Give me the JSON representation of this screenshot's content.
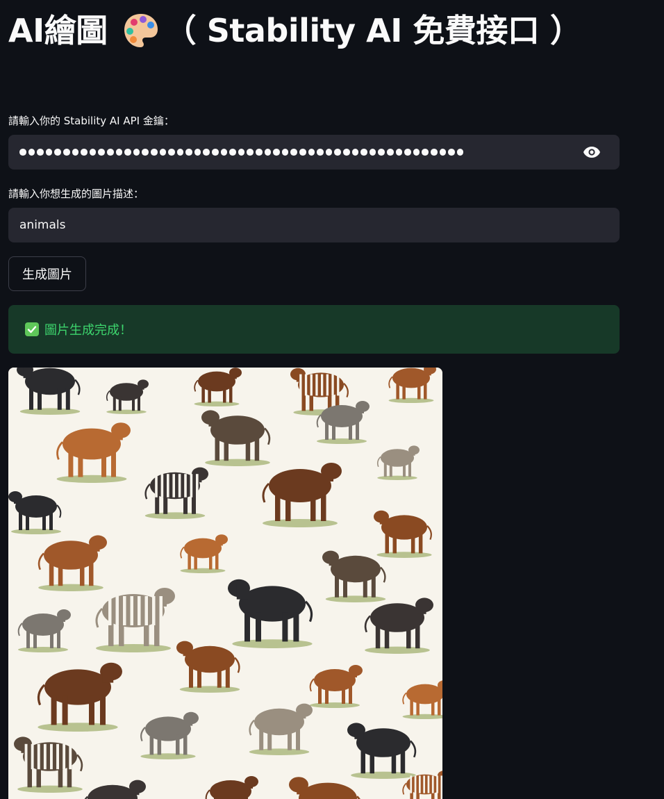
{
  "header": {
    "title_prefix": "AI繪圖",
    "title_suffix": "（ Stability AI 免費接口 ）",
    "title_icon": "palette-icon"
  },
  "api_key": {
    "label": "請輸入你的 Stability AI API 金鑰：",
    "masked_length": 51,
    "toggle_icon": "eye-icon"
  },
  "prompt": {
    "label": "請輸入你想生成的圖片描述：",
    "value": "animals"
  },
  "generate_button": {
    "label": "生成圖片"
  },
  "status": {
    "icon": "check-box-icon",
    "message": "圖片生成完成！"
  },
  "result_image": {
    "subject": "animals"
  },
  "colors": {
    "background": "#0e1117",
    "input_bg": "#262730",
    "success_bg": "#173928",
    "success_text": "#3dd56d",
    "check_green": "#5fc75a"
  }
}
